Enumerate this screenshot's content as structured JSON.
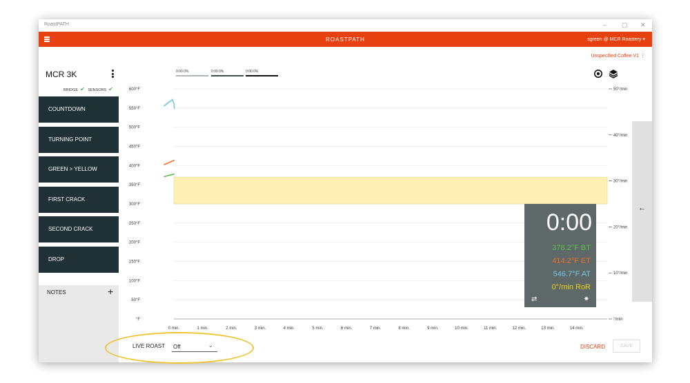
{
  "window": {
    "title": "RoastPATH",
    "min": "–",
    "restore": "▢",
    "close": "✕"
  },
  "app": {
    "brand": "ROASTPATH",
    "user": "sgreen @ MCR Roastery ▾",
    "coffee": "Unspecified Coffee V1 ⋮"
  },
  "machine": {
    "name": "MCR 3K",
    "bridge_label": "BRIDGE",
    "sensors_label": "SENSORS",
    "check": "✔"
  },
  "events": [
    "COUNTDOWN",
    "TURNING POINT",
    "GREEN > YELLOW",
    "FIRST CRACK",
    "SECOND CRACK",
    "DROP"
  ],
  "notes": {
    "label": "NOTES",
    "plus": "+"
  },
  "legend": [
    {
      "text": "0:00  0%",
      "color": "#b0b5b8"
    },
    {
      "text": "0:00  0%",
      "color": "#3e4e52"
    },
    {
      "text": "0:00  0%",
      "color": "#111111"
    }
  ],
  "readout": {
    "time": "0:00",
    "bt": "378.2°F BT",
    "et": "414.2°F ET",
    "at": "546.7°F AT",
    "ror": "0°/min RoR"
  },
  "colors": {
    "bt": "#5cc04f",
    "et": "#f07030",
    "at": "#7cc4e0",
    "ror": "#e8d21a",
    "band": "#fdf0b5"
  },
  "controls": {
    "live_roast": "LIVE ROAST",
    "mode": "Off",
    "discard": "DISCARD",
    "save": "SAVE"
  },
  "icons": {
    "back": "arrow-left-icon",
    "swap": "swap-icon",
    "gear": "gear-icon",
    "target": "target-icon",
    "layers": "layers-icon"
  },
  "chart_data": {
    "type": "line",
    "x_ticks": [
      "0 min.",
      "1 min.",
      "2 min.",
      "3 min.",
      "4 min.",
      "5 min.",
      "6 min.",
      "7 min.",
      "8 min.",
      "9 min.",
      "10 min.",
      "11 min.",
      "12 min.",
      "13 min.",
      "14 min."
    ],
    "y_ticks": [
      "°F",
      "50°F",
      "100°F",
      "150°F",
      "200°F",
      "250°F",
      "300°F",
      "350°F",
      "400°F",
      "450°F",
      "500°F",
      "550°F",
      "600°F"
    ],
    "y2_ticks": [
      "°/min",
      "10°/min",
      "20°/min",
      "30°/min",
      "40°/min",
      "50°/min"
    ],
    "xlim": [
      0,
      15
    ],
    "ylim": [
      0,
      600
    ],
    "y2lim": [
      0,
      50
    ],
    "band": [
      300,
      370
    ],
    "series": [
      {
        "key": "at",
        "x": [
          -0.35,
          -0.05,
          0.0,
          0.02
        ],
        "y": [
          555,
          572,
          562,
          548
        ]
      },
      {
        "key": "et",
        "x": [
          -0.35,
          0.02
        ],
        "y": [
          402,
          414
        ]
      },
      {
        "key": "bt",
        "x": [
          -0.35,
          0.02
        ],
        "y": [
          371,
          378
        ]
      }
    ]
  }
}
